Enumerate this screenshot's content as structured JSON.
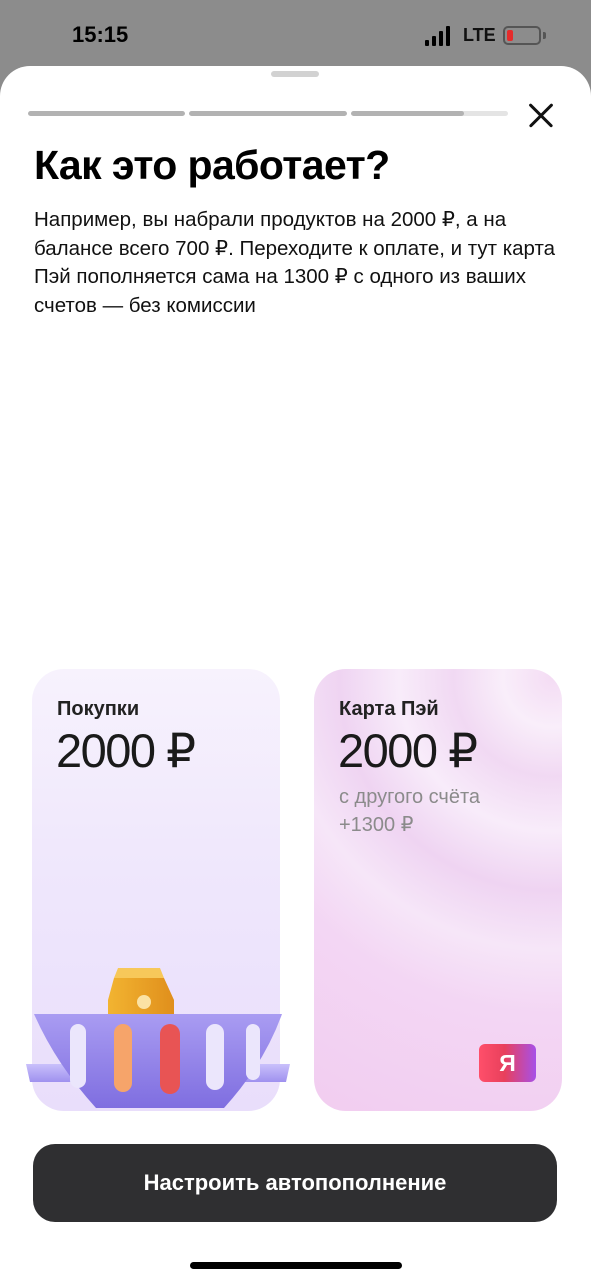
{
  "status_bar": {
    "time": "15:15",
    "network": "LTE",
    "battery_level": 0.2,
    "battery_color": "#e52b2b"
  },
  "onboarding": {
    "progress_fill": [
      1,
      1,
      0.72
    ],
    "close_icon": "close-icon",
    "title": "Как это работает?",
    "description": "Например, вы набрали продуктов на 2000 ₽, а на балансе всего 700 ₽. Переходите к оплате, и тут карта Пэй  пополняется сама на 1300 ₽ с одного из ваших счетов — без комиссии"
  },
  "cards": {
    "purchases": {
      "label": "Покупки",
      "amount": "2000 ₽",
      "illustration": "grocery-basket"
    },
    "pay_card": {
      "label": "Карта Пэй",
      "amount": "2000 ₽",
      "sub_line_1": "с другого счёта",
      "sub_line_2": "+1300 ₽",
      "logo_letter": "Я"
    }
  },
  "cta": {
    "label": "Настроить автопополнение"
  },
  "colors": {
    "cta_background": "#2f2f31",
    "logo_gradient_start": "#ff4f6a",
    "logo_gradient_end": "#a750e8"
  }
}
